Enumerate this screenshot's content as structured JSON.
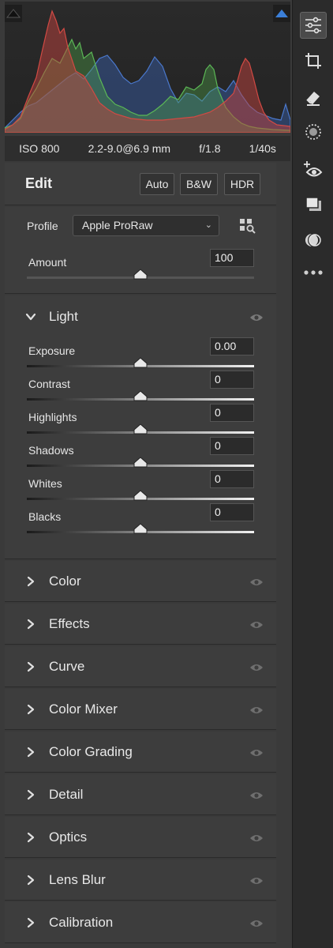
{
  "camera_info": {
    "iso": "ISO 800",
    "lens": "2.2-9.0@6.9 mm",
    "aperture": "f/1.8",
    "shutter": "1/40s"
  },
  "edit": {
    "title": "Edit",
    "buttons": {
      "auto": "Auto",
      "bw": "B&W",
      "hdr": "HDR"
    }
  },
  "profile": {
    "label": "Profile",
    "selected": "Apple ProRaw",
    "amount_label": "Amount",
    "amount_value": "100",
    "amount_level": 0.5
  },
  "light": {
    "title": "Light",
    "sliders": [
      {
        "label": "Exposure",
        "value": "0.00",
        "level": 0.5
      },
      {
        "label": "Contrast",
        "value": "0",
        "level": 0.5
      },
      {
        "label": "Highlights",
        "value": "0",
        "level": 0.5
      },
      {
        "label": "Shadows",
        "value": "0",
        "level": 0.5
      },
      {
        "label": "Whites",
        "value": "0",
        "level": 0.5
      },
      {
        "label": "Blacks",
        "value": "0",
        "level": 0.5
      }
    ]
  },
  "sections": [
    "Color",
    "Effects",
    "Curve",
    "Color Mixer",
    "Color Grading",
    "Detail",
    "Optics",
    "Lens Blur",
    "Calibration"
  ],
  "toolbar": {
    "tools": [
      "edit-sliders-icon",
      "crop-icon",
      "eraser-icon",
      "masking-icon",
      "red-eye-icon",
      "presets-icon",
      "snapshots-icon",
      "more-icon"
    ]
  },
  "colors": {
    "panel_bg": "#3d3d3d",
    "toolbar_bg": "#2b2b2b",
    "histogram_red": "#c0413d",
    "histogram_green": "#4fa64a",
    "histogram_blue": "#3a62b0",
    "clip_highlight_blue": "#3b7fd8"
  }
}
